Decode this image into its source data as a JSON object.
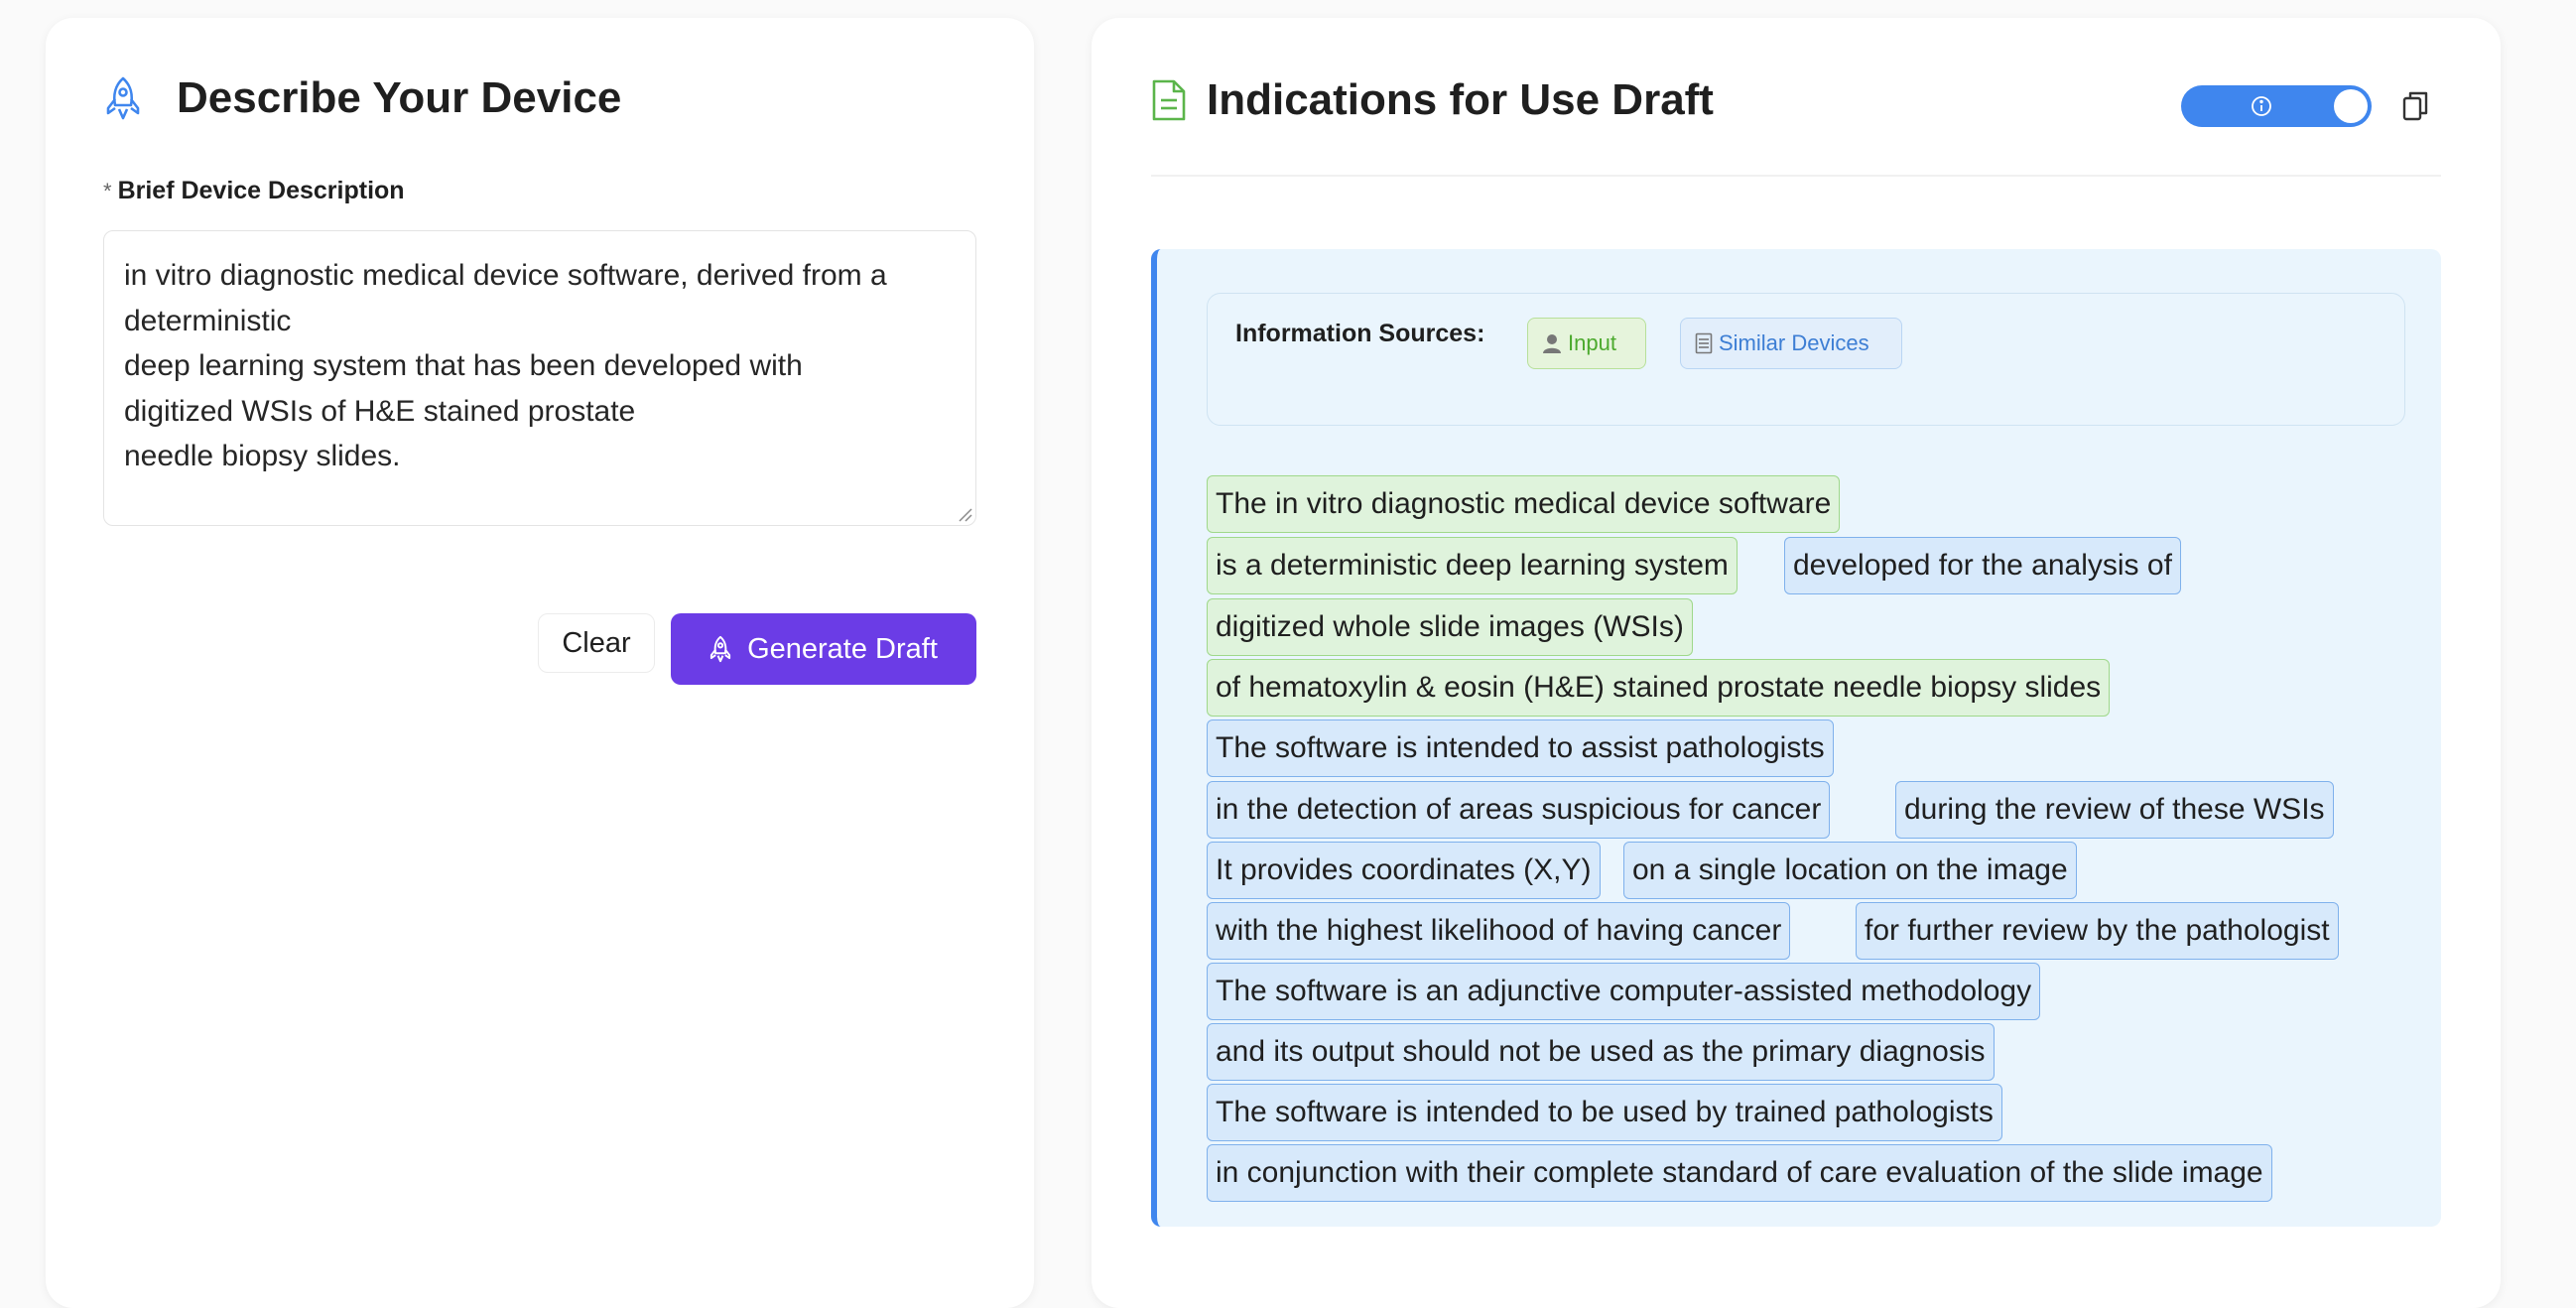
{
  "left": {
    "title": "Describe Your Device",
    "field_required_mark": "*",
    "field_label": "Brief Device Description",
    "description_value": "in vitro diagnostic medical device software, derived from a deterministic\ndeep learning system that has been developed with\ndigitized WSIs of H&E stained prostate\nneedle biopsy slides.",
    "clear_label": "Clear",
    "generate_label": "Generate Draft",
    "icons": {
      "title_icon": "rocket-icon",
      "generate_icon": "rocket-icon"
    },
    "accent_color": "#6b3ce6"
  },
  "right": {
    "title": "Indications for Use Draft",
    "icons": {
      "title_icon": "document-icon",
      "toggle_icon": "info-icon",
      "copy_icon": "copy-icon"
    },
    "toggle_on": true,
    "sources_label": "Information Sources:",
    "sources": [
      {
        "label": "Input",
        "icon": "user-icon",
        "color": "#4caa2e"
      },
      {
        "label": "Similar Devices",
        "icon": "document-icon",
        "color": "#3d7ed4"
      }
    ],
    "segments": [
      {
        "text": "The in vitro diagnostic medical device software",
        "source": "input"
      },
      {
        "text": "is a deterministic deep learning system",
        "source": "input"
      },
      {
        "text": "developed for the analysis of",
        "source": "similar"
      },
      {
        "text": "digitized whole slide images (WSIs)",
        "source": "input"
      },
      {
        "text": "of hematoxylin & eosin (H&E) stained prostate needle biopsy slides",
        "source": "input"
      },
      {
        "text": "The software is intended to assist pathologists",
        "source": "similar"
      },
      {
        "text": "in the detection of areas suspicious for cancer",
        "source": "similar"
      },
      {
        "text": "during the review of these WSIs",
        "source": "similar"
      },
      {
        "text": "It provides coordinates (X,Y)",
        "source": "similar"
      },
      {
        "text": "on a single location on the image",
        "source": "similar"
      },
      {
        "text": "with the highest likelihood of having cancer",
        "source": "similar"
      },
      {
        "text": "for further review by the pathologist",
        "source": "similar"
      },
      {
        "text": "The software is an adjunctive computer-assisted methodology",
        "source": "similar"
      },
      {
        "text": "and its output should not be used as the primary diagnosis",
        "source": "similar"
      },
      {
        "text": "The software is intended to be used by trained pathologists",
        "source": "similar"
      },
      {
        "text": "in conjunction with their complete standard of care evaluation of the slide image",
        "source": "similar"
      }
    ]
  }
}
